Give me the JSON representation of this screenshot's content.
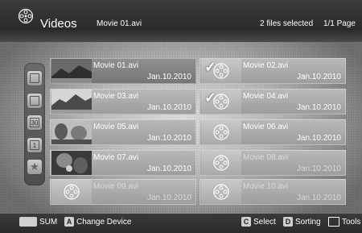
{
  "header": {
    "title": "Videos",
    "current_file": "Movie 01.avi",
    "selection": "2 files selected",
    "page": "1/1 Page"
  },
  "sidebar": {
    "items": [
      {
        "icon": "folder-icon"
      },
      {
        "icon": "folder-icon"
      },
      {
        "icon": "calendar-icon",
        "label": "30"
      },
      {
        "icon": "list-icon",
        "label": "1"
      },
      {
        "icon": "star-icon"
      }
    ]
  },
  "files": [
    {
      "name": "Movie 01.avi",
      "date": "Jan.10.2010",
      "thumbnail": "photo",
      "checked": false
    },
    {
      "name": "Movie 02.avi",
      "date": "Jan.10.2010",
      "thumbnail": "film-reel-icon",
      "checked": true
    },
    {
      "name": "Movie 03.avi",
      "date": "Jan.10.2010",
      "thumbnail": "photo",
      "checked": false
    },
    {
      "name": "Movie 04.avi",
      "date": "Jan.10.2010",
      "thumbnail": "film-reel-icon",
      "checked": true
    },
    {
      "name": "Movie 05.avi",
      "date": "Jan.10.2010",
      "thumbnail": "photo",
      "checked": false
    },
    {
      "name": "Movie 06.avi",
      "date": "Jan.10.2010",
      "thumbnail": "film-reel-icon",
      "checked": false
    },
    {
      "name": "Movie 07.avi",
      "date": "Jan.10.2010",
      "thumbnail": "photo",
      "checked": false
    },
    {
      "name": "Movie 08.avi",
      "date": "Jan.10.2010",
      "thumbnail": "film-reel-icon",
      "checked": false
    },
    {
      "name": "Movie 09.avi",
      "date": "Jan.10.2010",
      "thumbnail": "film-reel-icon",
      "checked": false
    },
    {
      "name": "Movie 10.avi",
      "date": "Jan.10.2010",
      "thumbnail": "film-reel-icon",
      "checked": false
    }
  ],
  "footer": {
    "sum_label": "SUM",
    "change_device_key": "A",
    "change_device_label": "Change Device",
    "select_key": "C",
    "select_label": "Select",
    "sorting_key": "D",
    "sorting_label": "Sorting",
    "tools_label": "Tools"
  }
}
